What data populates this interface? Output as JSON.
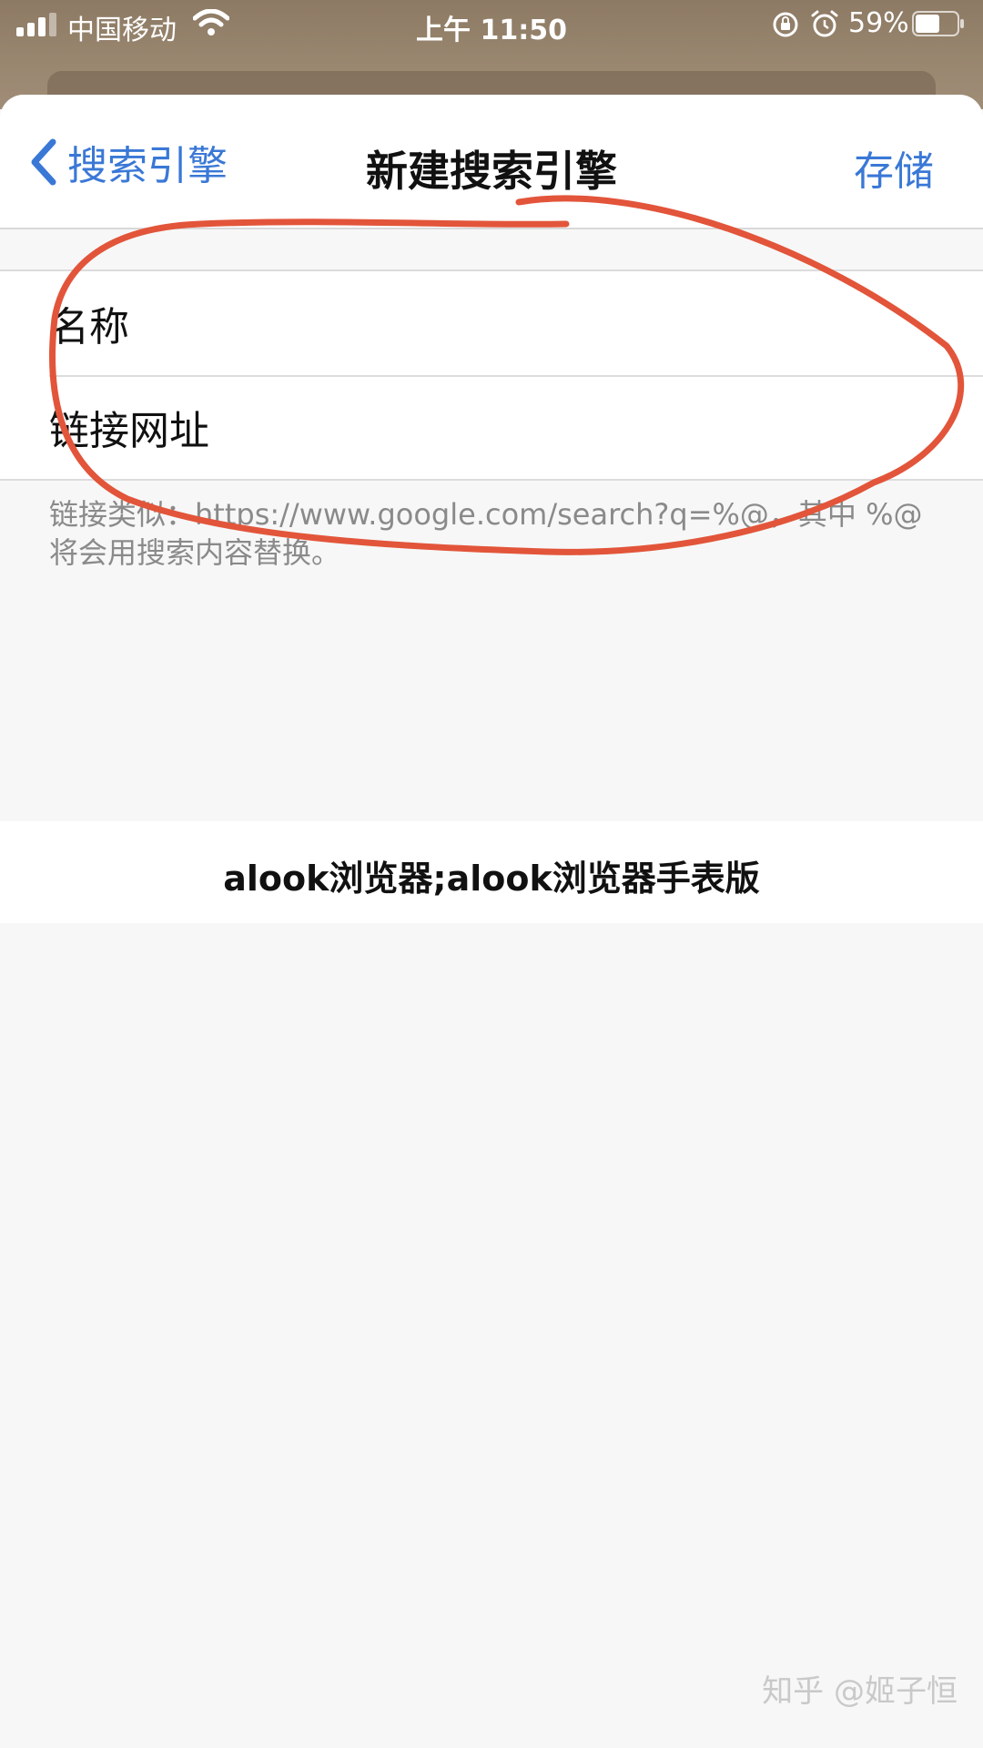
{
  "status_bar": {
    "carrier": "中国移动",
    "time": "上午 11:50",
    "battery_percent": "59%",
    "battery_level": 0.59,
    "icons": [
      "signal-icon",
      "wifi-icon",
      "orientation-lock-icon",
      "alarm-icon",
      "battery-icon"
    ]
  },
  "nav": {
    "back_label": "搜索引擎",
    "title": "新建搜索引擎",
    "save_label": "存储"
  },
  "form": {
    "rows": [
      {
        "label": "名称",
        "value": ""
      },
      {
        "label": "链接网址",
        "value": ""
      }
    ],
    "hint": "链接类似：https://www.google.com/search?q=%@，其中 %@ 将会用搜索内容替换。"
  },
  "banner": {
    "text": "alook浏览器;alook浏览器手表版"
  },
  "watermark": {
    "text": "知乎 @姬子恒"
  },
  "colors": {
    "accent": "#3a78d6",
    "annotation": "#e2553a"
  }
}
